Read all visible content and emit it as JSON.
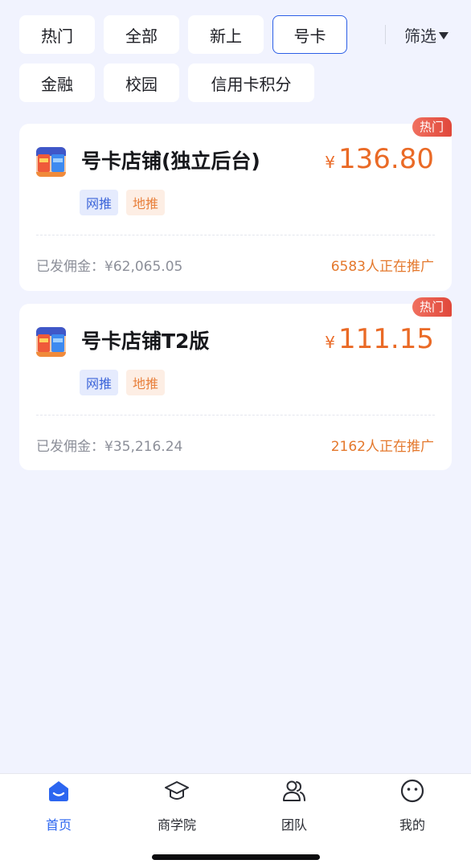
{
  "colors": {
    "accent": "#2c66f0",
    "price": "#ea6a26",
    "hot_badge": "#e0473a",
    "page_bg": "#f1f3fe"
  },
  "filters": {
    "chips": [
      "热门",
      "全部",
      "新上",
      "号卡",
      "金融",
      "校园",
      "信用卡积分"
    ],
    "selected": "号卡",
    "filter_label": "筛选",
    "filter_icon": "caret-down-icon"
  },
  "products": [
    {
      "badge": "热门",
      "icon": "sim-card-shop-icon",
      "title": "号卡店铺(独立后台)",
      "currency": "¥",
      "price": "136.80",
      "tags": [
        "网推",
        "地推"
      ],
      "commission": "已发佣金：¥62,065.05",
      "promoting": "6583人正在推广"
    },
    {
      "badge": "热门",
      "icon": "sim-card-shop-icon",
      "title": "号卡店铺T2版",
      "currency": "¥",
      "price": "111.15",
      "tags": [
        "网推",
        "地推"
      ],
      "commission": "已发佣金：¥35,216.24",
      "promoting": "2162人正在推广"
    }
  ],
  "tabbar": {
    "items": [
      {
        "label": "首页",
        "icon": "home-icon",
        "active": true
      },
      {
        "label": "商学院",
        "icon": "graduation-cap-icon",
        "active": false
      },
      {
        "label": "团队",
        "icon": "team-icon",
        "active": false
      },
      {
        "label": "我的",
        "icon": "smiley-face-icon",
        "active": false
      }
    ]
  }
}
